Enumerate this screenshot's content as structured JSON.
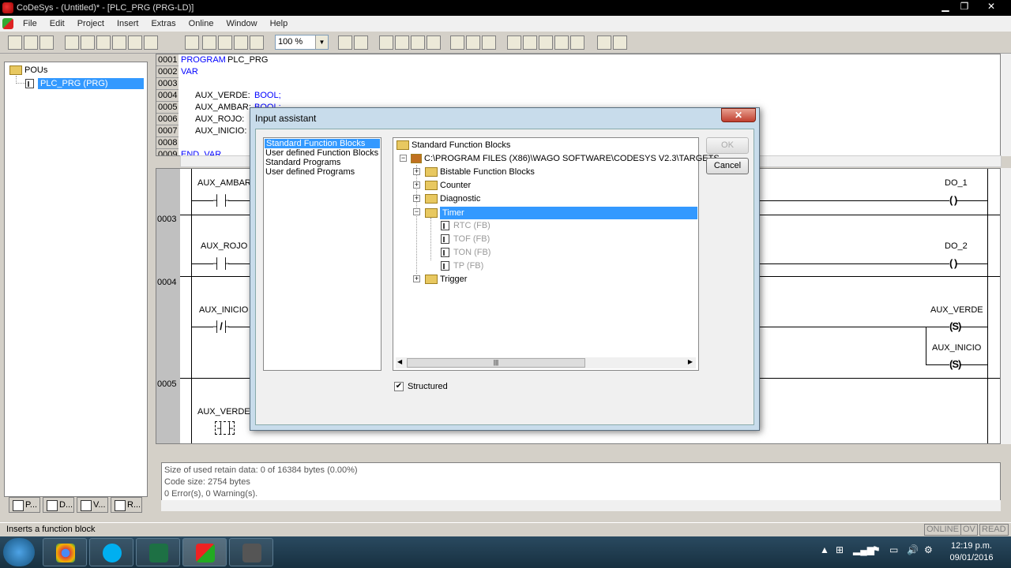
{
  "window": {
    "title": "CoDeSys - (Untitled)* - [PLC_PRG (PRG-LD)]",
    "min": "▁",
    "max": "❐",
    "close": "✕"
  },
  "menu": [
    "File",
    "Edit",
    "Project",
    "Insert",
    "Extras",
    "Online",
    "Window",
    "Help"
  ],
  "toolbar": {
    "zoom": "100 %"
  },
  "pou_tree": {
    "root": "POUs",
    "items": [
      "PLC_PRG (PRG)"
    ]
  },
  "left_tabs": [
    "P...",
    "D...",
    "V...",
    "R..."
  ],
  "declaration": {
    "lines": [
      "0001",
      "0002",
      "0003",
      "0004",
      "0005",
      "0006",
      "0007",
      "0008",
      "0009"
    ],
    "line1_kw": "PROGRAM",
    "line1_name": " PLC_PRG",
    "line2": "VAR",
    "vars": [
      {
        "name": "AUX_VERDE:",
        "type": "BOOL;"
      },
      {
        "name": "AUX_AMBAR:",
        "type": "BOOL;"
      },
      {
        "name": "AUX_ROJO:",
        "type": ""
      },
      {
        "name": "AUX_INICIO:",
        "type": ""
      }
    ],
    "end": "END_VAR"
  },
  "ladder": {
    "networks": [
      "0003",
      "0004",
      "0005"
    ],
    "contacts": [
      "AUX_AMBAR",
      "AUX_ROJO",
      "AUX_INICIO",
      "AUX_VERDE"
    ],
    "coils": [
      "DO_1",
      "DO_2",
      "AUX_VERDE",
      "AUX_INICIO"
    ],
    "symbols": {
      "no": "┤ ├",
      "nc": "┤/├",
      "coil": "( )",
      "set": "(S)"
    }
  },
  "messages": [
    "Size of used retain data: 0 of 16384 bytes (0.00%)",
    "Code size: 2754 bytes",
    "0 Error(s), 0 Warning(s)."
  ],
  "status": {
    "text": "Inserts a function block",
    "online": "ONLINE",
    "ov": "OV",
    "read": "READ"
  },
  "dialog": {
    "title": "Input assistant",
    "close": "✕",
    "categories": [
      "Standard Function Blocks",
      "User defined Function Blocks",
      "Standard Programs",
      "User defined Programs"
    ],
    "tree_root": "Standard Function Blocks",
    "path": "C:\\PROGRAM FILES (X86)\\WAGO SOFTWARE\\CODESYS V2.3\\TARGETS",
    "folders": [
      "Bistable Function Blocks",
      "Counter",
      "Diagnostic",
      "Timer",
      "Trigger"
    ],
    "timer_items": [
      "RTC (FB)",
      "TOF (FB)",
      "TON (FB)",
      "TP (FB)"
    ],
    "ok": "OK",
    "cancel": "Cancel",
    "structured": "Structured"
  },
  "taskbar": {
    "time": "12:19 p.m.",
    "date": "09/01/2016"
  }
}
